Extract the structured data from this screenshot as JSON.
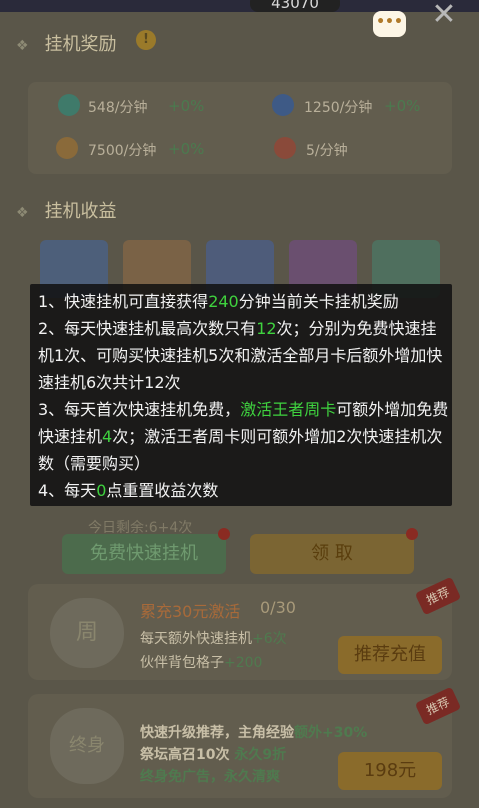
{
  "top": {
    "score": "43070"
  },
  "idle_reward": {
    "title": "挂机奖励",
    "info_badge": "!",
    "rates": [
      {
        "value": "548/分钟",
        "bonus": "+0%",
        "icon": "star-exp-icon"
      },
      {
        "value": "1250/分钟",
        "bonus": "+0%",
        "icon": "exp-orb-icon"
      },
      {
        "value": "7500/分钟",
        "bonus": "+0%",
        "icon": "coin-icon"
      },
      {
        "value": "5/分钟",
        "bonus": "",
        "icon": "medal-icon"
      }
    ]
  },
  "idle_income": {
    "title": "挂机收益"
  },
  "tooltip": {
    "line1_pre": "1、快速挂机可直接获得",
    "line1_num": "240",
    "line1_post": "分钟当前关卡挂机奖励",
    "line2_pre": "2、每天快速挂机最高次数只有",
    "line2_num": "12",
    "line2_post": "次；分别为免费快速挂机1次、可购买快速挂机5次和激活全部月卡后额外增加快速挂机6次共计12次",
    "line3_pre": "3、每天首次快速挂机免费，",
    "line3_hl": "激活王者周卡",
    "line3_mid": "可额外增加免费快速挂机",
    "line3_num": "4",
    "line3_post": "次；激活王者周卡则可额外增加2次快速挂机次数（需要购买）",
    "line4_pre": "4、每天",
    "line4_num": "0",
    "line4_post": "点重置收益次数"
  },
  "actions": {
    "remaining": "今日剩余:6+4次",
    "free_button": "免费快速挂机",
    "claim_button": "领 取"
  },
  "promo1": {
    "ribbon": "推荐",
    "badge_char": "周",
    "title": "累充30元激活",
    "progress": "0/30",
    "line1_pre": "每天额外快速挂机",
    "line1_val": "+6次",
    "line2_pre": "伙伴背包格子",
    "line2_val": "+200",
    "button": "推荐充值"
  },
  "promo2": {
    "ribbon": "推荐",
    "badge_char": "终身",
    "line1_pre": "快速升级推荐，主角经验",
    "line1_val": "额外+30%",
    "line2_pre": "祭坛高召10次",
    "line2_val": "永久9折",
    "line3": "终身免广告，永久清爽",
    "button": "198元"
  }
}
